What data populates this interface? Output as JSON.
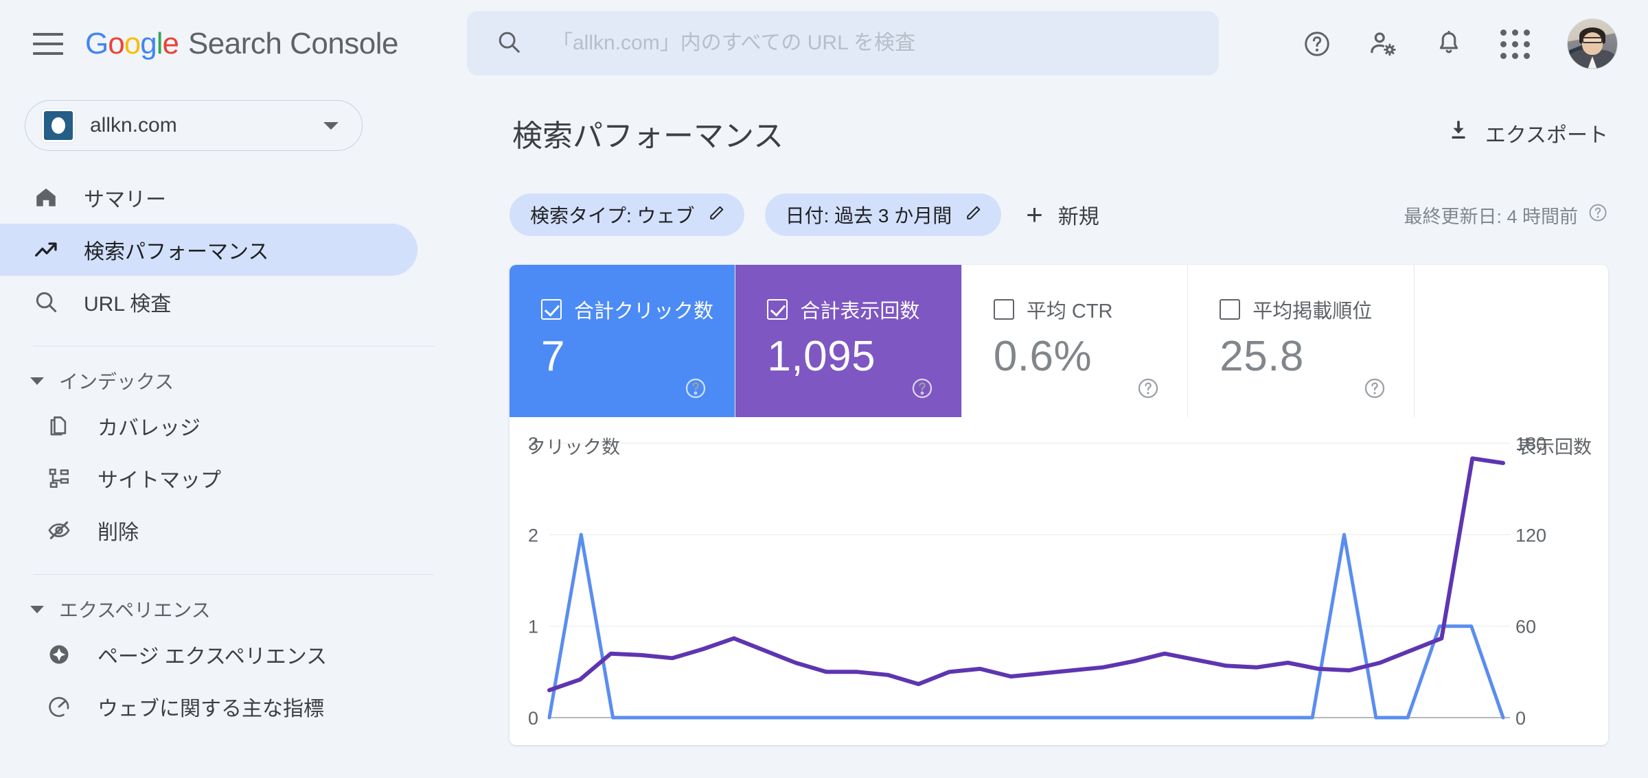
{
  "header": {
    "menu_icon": "hamburger-menu-icon",
    "brand_google": "Google",
    "brand_product": "Search Console",
    "search": {
      "icon": "search-icon",
      "placeholder": "「allkn.com」内のすべての URL を検査",
      "value": ""
    },
    "icons": [
      {
        "name": "help-icon",
        "label": "ヘルプ"
      },
      {
        "name": "account-settings-icon",
        "label": "アカウント設定"
      },
      {
        "name": "notifications-bell-icon",
        "label": "通知"
      },
      {
        "name": "google-apps-grid-icon",
        "label": "Google アプリ"
      },
      {
        "name": "user-avatar",
        "label": "アカウント"
      }
    ]
  },
  "sidebar": {
    "property": {
      "icon": "property-site-icon",
      "name": "allkn.com",
      "caret": "chevron-down-icon"
    },
    "items": [
      {
        "label": "サマリー",
        "icon": "home-icon",
        "active": false
      },
      {
        "label": "検索パフォーマンス",
        "icon": "trending-up-icon",
        "active": true
      },
      {
        "label": "URL 検査",
        "icon": "search-icon",
        "active": false
      }
    ],
    "groups": [
      {
        "label": "インデックス",
        "expanded": true,
        "items": [
          {
            "label": "カバレッジ",
            "icon": "pages-copy-icon"
          },
          {
            "label": "サイトマップ",
            "icon": "sitemap-icon"
          },
          {
            "label": "削除",
            "icon": "eye-off-icon"
          }
        ]
      },
      {
        "label": "エクスペリエンス",
        "expanded": true,
        "items": [
          {
            "label": "ページ エクスペリエンス",
            "icon": "page-experience-icon"
          },
          {
            "label": "ウェブに関する主な指標",
            "icon": "speedometer-icon"
          }
        ]
      }
    ]
  },
  "main": {
    "page_title": "検索パフォーマンス",
    "export": {
      "label": "エクスポート",
      "icon": "download-icon"
    },
    "filters": [
      {
        "label": "検索タイプ: ウェブ",
        "edit_icon": "pencil-icon"
      },
      {
        "label": "日付: 過去 3 か月間",
        "edit_icon": "pencil-icon"
      }
    ],
    "new_filter": {
      "label": "新規",
      "icon": "plus-icon"
    },
    "last_updated": {
      "text": "最終更新日: 4 時間前",
      "help_icon": "help-circle-icon"
    },
    "metrics": [
      {
        "label": "合計クリック数",
        "value": "7",
        "checked": true,
        "style": "sel-blue",
        "help_icon": "help-circle-icon"
      },
      {
        "label": "合計表示回数",
        "value": "1,095",
        "checked": true,
        "style": "sel-purple",
        "help_icon": "help-circle-icon"
      },
      {
        "label": "平均 CTR",
        "value": "0.6%",
        "checked": false,
        "style": "plain",
        "help_icon": "help-circle-icon"
      },
      {
        "label": "平均掲載順位",
        "value": "25.8",
        "checked": false,
        "style": "plain",
        "help_icon": "help-circle-icon"
      }
    ]
  },
  "colors": {
    "clicks_blue": "#4C8BF5",
    "impressions_purple": "#7E57C2",
    "clicks_line": "#5A8DF0",
    "impressions_line": "#5E35B1",
    "sidebar_active": "#D2E0FB",
    "chip_bg": "#D2E0FB",
    "page_bg": "#F1F5FA"
  },
  "chart_data": {
    "type": "line",
    "title": "",
    "ylabel": "クリック数",
    "y2label": "表示回数",
    "xlabel": "",
    "grid": true,
    "legend_position": "none",
    "ylim": [
      0,
      3
    ],
    "y2lim": [
      0,
      180
    ],
    "yticks": [
      "0",
      "1",
      "2",
      "3"
    ],
    "y2ticks": [
      "0",
      "60",
      "120",
      "180"
    ],
    "series": [
      {
        "name": "クリック数",
        "axis": "left",
        "color": "#5A8DF0",
        "values": [
          0,
          2,
          0,
          0,
          0,
          0,
          0,
          0,
          0,
          0,
          0,
          0,
          0,
          0,
          0,
          0,
          0,
          0,
          0,
          0,
          0,
          0,
          0,
          0,
          0,
          2,
          0,
          0,
          1,
          1,
          0
        ]
      },
      {
        "name": "表示回数",
        "axis": "right",
        "color": "#5E35B1",
        "values": [
          18,
          25,
          42,
          41,
          39,
          45,
          52,
          44,
          36,
          30,
          30,
          28,
          22,
          30,
          32,
          27,
          29,
          31,
          33,
          37,
          42,
          38,
          34,
          33,
          36,
          32,
          31,
          36,
          44,
          52,
          170,
          167
        ]
      }
    ]
  }
}
